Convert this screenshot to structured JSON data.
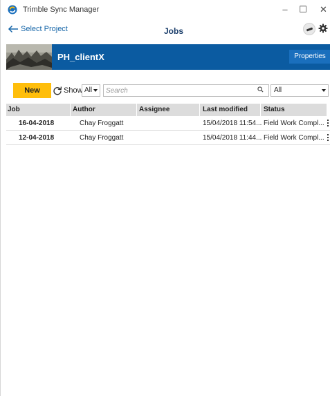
{
  "app": {
    "title": "Trimble Sync Manager",
    "window_controls": {
      "minimize": "–",
      "maximize": "☐",
      "close": "✕"
    }
  },
  "nav": {
    "back_label": "Select Project",
    "page_title": "Jobs"
  },
  "project": {
    "name": "PH_clientX",
    "properties_label": "Properties"
  },
  "toolbar": {
    "new_label": "New",
    "show_label": "Show",
    "show_value": "All",
    "search_placeholder": "Search",
    "status_filter_value": "All"
  },
  "table": {
    "columns": [
      "Job",
      "Author",
      "Assignee",
      "Last modified",
      "Status"
    ],
    "rows": [
      {
        "job": "16-04-2018",
        "author": "Chay Froggatt",
        "assignee": "",
        "last_modified": "15/04/2018 11:54...",
        "status": "Field Work Compl..."
      },
      {
        "job": "12-04-2018",
        "author": "Chay Froggatt",
        "assignee": "",
        "last_modified": "15/04/2018 11:44...",
        "status": "Field Work Compl..."
      }
    ]
  },
  "colors": {
    "accent_blue": "#0b5ba1",
    "new_button": "#ffbe0b",
    "link_blue": "#1565a8"
  }
}
